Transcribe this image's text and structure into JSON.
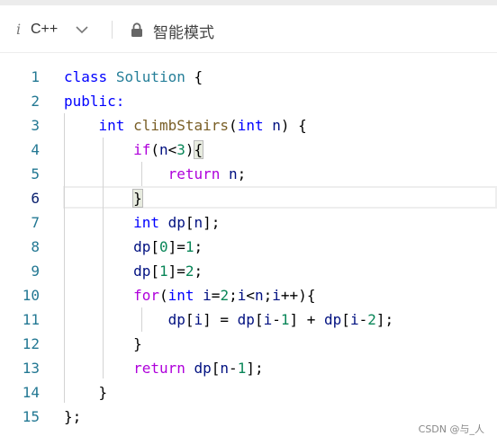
{
  "toolbar": {
    "info_icon_char": "i",
    "language": "C++",
    "mode_label": "智能模式",
    "icons": [
      "info-icon",
      "chevron-down-icon",
      "lock-icon"
    ]
  },
  "editor": {
    "active_line": 6,
    "line_numbers": [
      "1",
      "2",
      "3",
      "4",
      "5",
      "6",
      "7",
      "8",
      "9",
      "10",
      "11",
      "12",
      "13",
      "14",
      "15"
    ],
    "lines": [
      [
        {
          "t": "class",
          "c": "blue"
        },
        {
          "t": " "
        },
        {
          "t": "Solution",
          "c": "teal"
        },
        {
          "t": " {"
        }
      ],
      [
        {
          "t": "public:",
          "c": "blue"
        }
      ],
      [
        {
          "t": "    "
        },
        {
          "t": "int",
          "c": "blue"
        },
        {
          "t": " "
        },
        {
          "t": "climbStairs",
          "c": "fn"
        },
        {
          "t": "("
        },
        {
          "t": "int",
          "c": "blue"
        },
        {
          "t": " "
        },
        {
          "t": "n",
          "c": "var"
        },
        {
          "t": ") {"
        }
      ],
      [
        {
          "t": "        "
        },
        {
          "t": "if",
          "c": "purple"
        },
        {
          "t": "("
        },
        {
          "t": "n",
          "c": "var"
        },
        {
          "t": "<"
        },
        {
          "t": "3",
          "c": "num"
        },
        {
          "t": ")"
        },
        {
          "t": "{",
          "c": "brace"
        }
      ],
      [
        {
          "t": "            "
        },
        {
          "t": "return",
          "c": "purple"
        },
        {
          "t": " "
        },
        {
          "t": "n",
          "c": "var"
        },
        {
          "t": ";"
        }
      ],
      [
        {
          "t": "        "
        },
        {
          "t": "}",
          "c": "brace"
        }
      ],
      [
        {
          "t": "        "
        },
        {
          "t": "int",
          "c": "blue"
        },
        {
          "t": " "
        },
        {
          "t": "dp",
          "c": "var"
        },
        {
          "t": "["
        },
        {
          "t": "n",
          "c": "var"
        },
        {
          "t": "];"
        }
      ],
      [
        {
          "t": "        "
        },
        {
          "t": "dp",
          "c": "var"
        },
        {
          "t": "["
        },
        {
          "t": "0",
          "c": "num"
        },
        {
          "t": "]="
        },
        {
          "t": "1",
          "c": "num"
        },
        {
          "t": ";"
        }
      ],
      [
        {
          "t": "        "
        },
        {
          "t": "dp",
          "c": "var"
        },
        {
          "t": "["
        },
        {
          "t": "1",
          "c": "num"
        },
        {
          "t": "]="
        },
        {
          "t": "2",
          "c": "num"
        },
        {
          "t": ";"
        }
      ],
      [
        {
          "t": "        "
        },
        {
          "t": "for",
          "c": "purple"
        },
        {
          "t": "("
        },
        {
          "t": "int",
          "c": "blue"
        },
        {
          "t": " "
        },
        {
          "t": "i",
          "c": "var"
        },
        {
          "t": "="
        },
        {
          "t": "2",
          "c": "num"
        },
        {
          "t": ";"
        },
        {
          "t": "i",
          "c": "var"
        },
        {
          "t": "<"
        },
        {
          "t": "n",
          "c": "var"
        },
        {
          "t": ";"
        },
        {
          "t": "i",
          "c": "var"
        },
        {
          "t": "++){"
        }
      ],
      [
        {
          "t": "            "
        },
        {
          "t": "dp",
          "c": "var"
        },
        {
          "t": "["
        },
        {
          "t": "i",
          "c": "var"
        },
        {
          "t": "] = "
        },
        {
          "t": "dp",
          "c": "var"
        },
        {
          "t": "["
        },
        {
          "t": "i",
          "c": "var"
        },
        {
          "t": "-"
        },
        {
          "t": "1",
          "c": "num"
        },
        {
          "t": "] + "
        },
        {
          "t": "dp",
          "c": "var"
        },
        {
          "t": "["
        },
        {
          "t": "i",
          "c": "var"
        },
        {
          "t": "-"
        },
        {
          "t": "2",
          "c": "num"
        },
        {
          "t": "];"
        }
      ],
      [
        {
          "t": "        }"
        }
      ],
      [
        {
          "t": "        "
        },
        {
          "t": "return",
          "c": "purple"
        },
        {
          "t": " "
        },
        {
          "t": "dp",
          "c": "var"
        },
        {
          "t": "["
        },
        {
          "t": "n",
          "c": "var"
        },
        {
          "t": "-"
        },
        {
          "t": "1",
          "c": "num"
        },
        {
          "t": "];"
        }
      ],
      [
        {
          "t": "    }"
        }
      ],
      [
        {
          "t": "};"
        }
      ]
    ]
  },
  "watermark": "CSDN @与_人",
  "colors": {
    "keyword": "#0000ff",
    "control": "#af00db",
    "type": "#267f99",
    "function": "#795e26",
    "variable": "#001080",
    "number": "#098658",
    "line_number": "#237893"
  }
}
